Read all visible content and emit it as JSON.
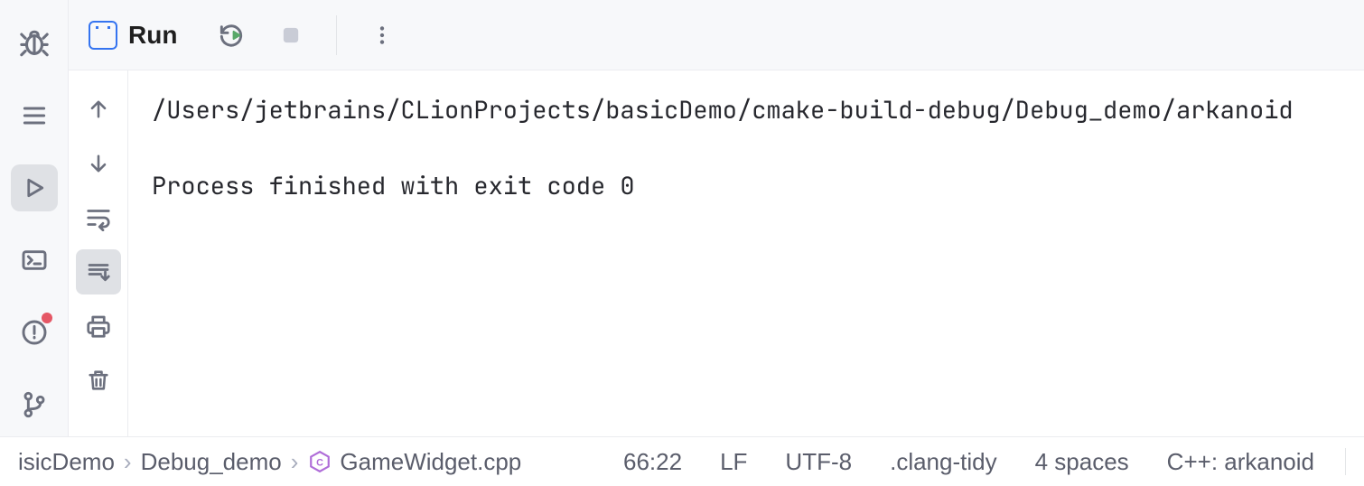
{
  "toolwindow": {
    "title": "Run"
  },
  "console": {
    "command_line": "/Users/jetbrains/CLionProjects/basicDemo/cmake-build-debug/Debug_demo/arkanoid",
    "exit_line": "Process finished with exit code 0"
  },
  "breadcrumbs": {
    "items": [
      "isicDemo",
      "Debug_demo",
      "GameWidget.cpp"
    ]
  },
  "status": {
    "caret": "66:22",
    "line_sep": "LF",
    "encoding": "UTF-8",
    "inspections": ".clang-tidy",
    "indent": "4 spaces",
    "context": "C++: arkanoid"
  },
  "icons": {
    "debug": "bug-icon",
    "structure": "structure-icon",
    "run": "play-icon",
    "terminal": "terminal-icon",
    "problems": "problems-icon",
    "vcs": "git-branch-icon",
    "rerun": "rerun-icon",
    "stop": "stop-icon",
    "more": "more-icon",
    "up": "arrow-up-icon",
    "down": "arrow-down-icon",
    "wrap": "soft-wrap-icon",
    "scroll_end": "scroll-to-end-icon",
    "print": "print-icon",
    "clear": "trash-icon",
    "cpp_file": "cpp-file-icon"
  }
}
